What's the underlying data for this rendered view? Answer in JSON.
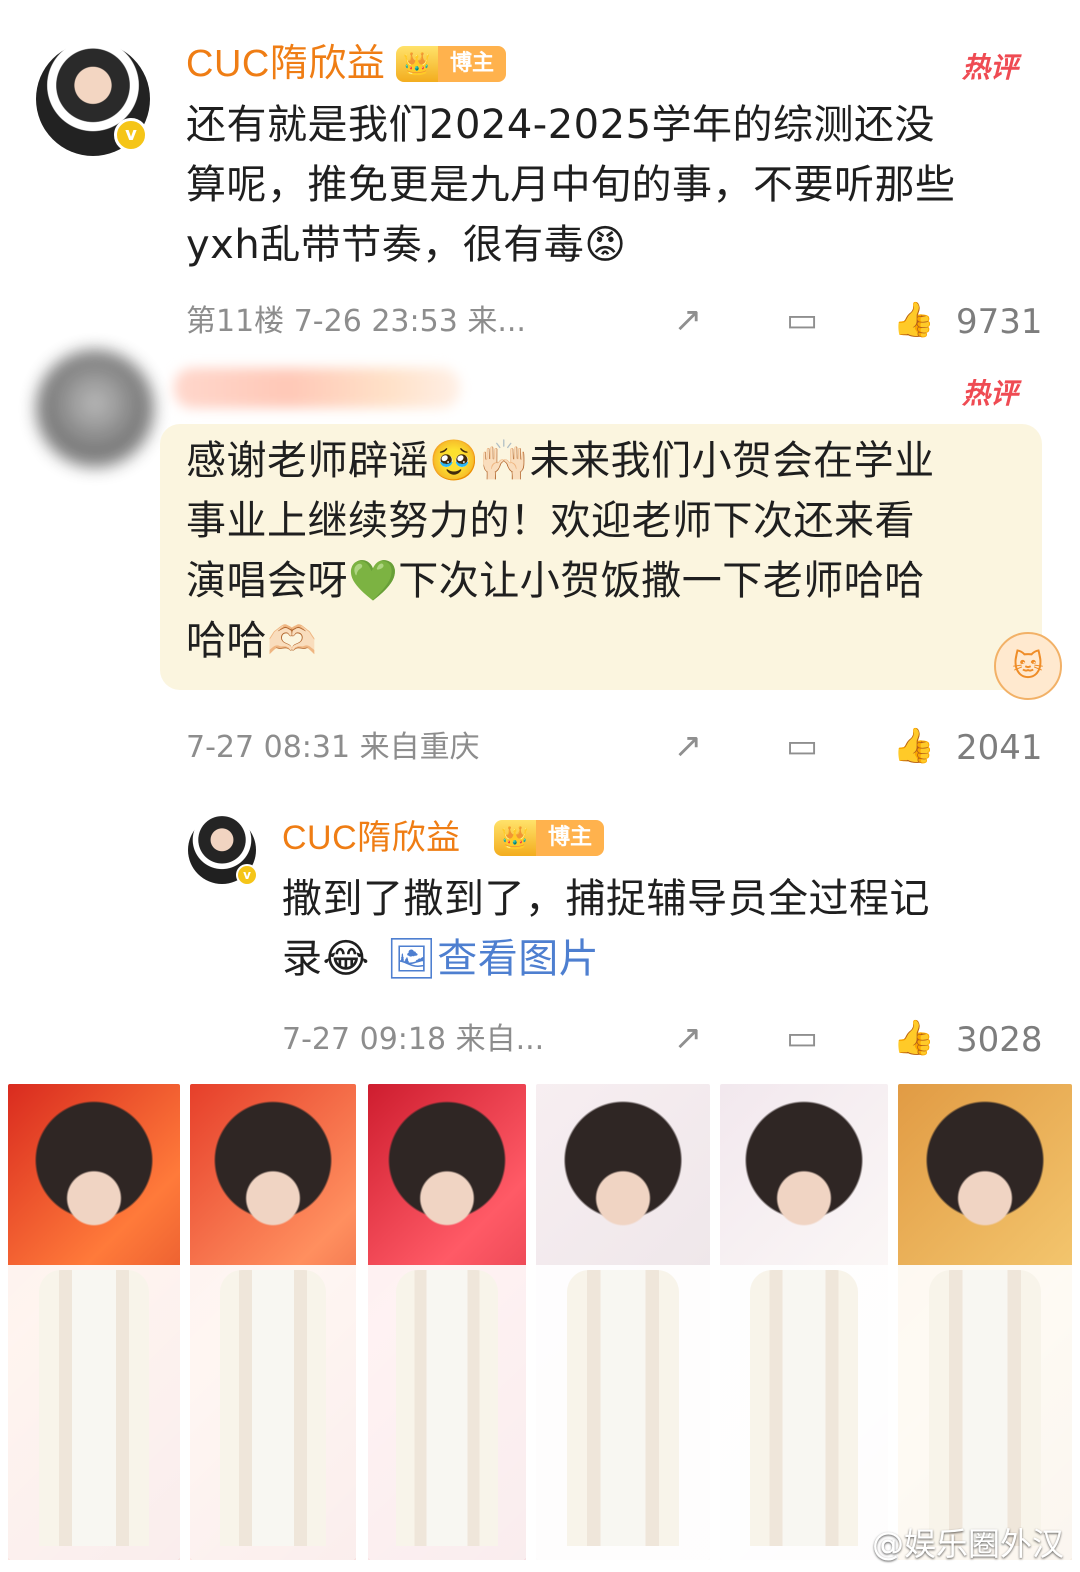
{
  "comments": [
    {
      "name": "CUC隋欣益",
      "tag": "博主",
      "hot": "热评",
      "text": [
        "还有就是我们2024-2025学年的综测还没",
        "算呢，推免更是九月中旬的事，不要听那些",
        "yxh乱带节奏，很有毒😡"
      ],
      "meta": "第11楼 7-26 23:53 来...",
      "likes": "9731"
    },
    {
      "hot": "热评",
      "text": [
        "感谢老师辟谣🥹🙌🏻未来我们小贺会在学业",
        "事业上继续努力的！欢迎老师下次还来看",
        "演唱会呀💚下次让小贺饭撒一下老师哈哈",
        "哈哈🫶🏻"
      ],
      "meta": "7-27 08:31 来自重庆",
      "likes": "2041"
    },
    {
      "name": "CUC隋欣益",
      "tag": "博主",
      "text": [
        "撒到了撒到了，捕捉辅导员全过程记",
        "录😂"
      ],
      "link": "🖼查看图片",
      "meta": "7-27 09:18 来自...",
      "likes": "3028"
    }
  ],
  "icons": {
    "share": "↗",
    "comment": "▭",
    "like": "👍",
    "crown": "👑",
    "verified": "v"
  },
  "watermark": "@娱乐圈外汉",
  "colors": {
    "username": "#ef7d14",
    "hot": "#ef4b53",
    "meta": "#8d8d8d",
    "bubble": "#fbf5df",
    "link": "#4e7fd0"
  }
}
